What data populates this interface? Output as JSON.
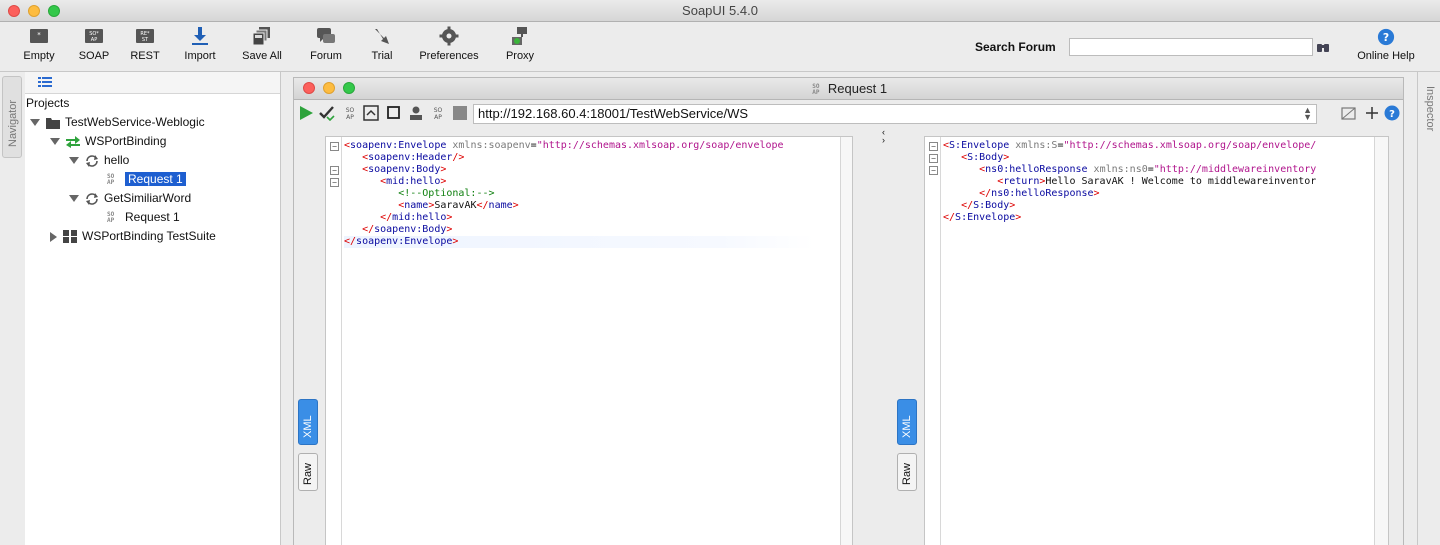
{
  "window": {
    "title": "SoapUI 5.4.0"
  },
  "toolbar": {
    "buttons": [
      {
        "label": "Empty",
        "icon": "empty-project-icon"
      },
      {
        "label": "SOAP",
        "icon": "soap-icon"
      },
      {
        "label": "REST",
        "icon": "rest-icon"
      },
      {
        "label": "Import",
        "icon": "import-icon"
      },
      {
        "label": "Save All",
        "icon": "save-all-icon"
      },
      {
        "label": "Forum",
        "icon": "forum-icon"
      },
      {
        "label": "Trial",
        "icon": "trial-icon"
      },
      {
        "label": "Preferences",
        "icon": "gear-icon"
      },
      {
        "label": "Proxy",
        "icon": "proxy-icon"
      }
    ],
    "search_label": "Search Forum",
    "search_value": "",
    "online_help_label": "Online Help"
  },
  "navigator": {
    "strip_label": "Navigator",
    "projects_label": "Projects",
    "tree": [
      {
        "label": "TestWebService-Weblogic"
      },
      {
        "label": "WSPortBinding"
      },
      {
        "label": "hello"
      },
      {
        "label": "Request 1"
      },
      {
        "label": "GetSimiliarWord"
      },
      {
        "label": "Request 1"
      },
      {
        "label": "WSPortBinding TestSuite"
      }
    ],
    "mini_icon_text": "SO\nAP"
  },
  "inspector": {
    "label": "Inspector"
  },
  "request": {
    "title": "Request 1",
    "endpoint": "http://192.168.60.4:18001/TestWebService/WS",
    "tabs": {
      "xml": "XML",
      "raw": "Raw"
    },
    "request_xml": [
      "<soapenv:Envelope xmlns:soapenv=\"http://schemas.xmlsoap.org/soap/envelope",
      "   <soapenv:Header/>",
      "   <soapenv:Body>",
      "      <mid:hello>",
      "         <!--Optional:-->",
      "         <name>SaravAK</name>",
      "      </mid:hello>",
      "   </soapenv:Body>",
      "</soapenv:Envelope>"
    ],
    "response_xml": [
      "<S:Envelope xmlns:S=\"http://schemas.xmlsoap.org/soap/envelope/",
      "   <S:Body>",
      "      <ns0:helloResponse xmlns:ns0=\"http://middlewareinventory",
      "         <return>Hello SaravAK ! Welcome to middlewareinventor",
      "      </ns0:helloResponse>",
      "   </S:Body>",
      "</S:Envelope>"
    ]
  }
}
